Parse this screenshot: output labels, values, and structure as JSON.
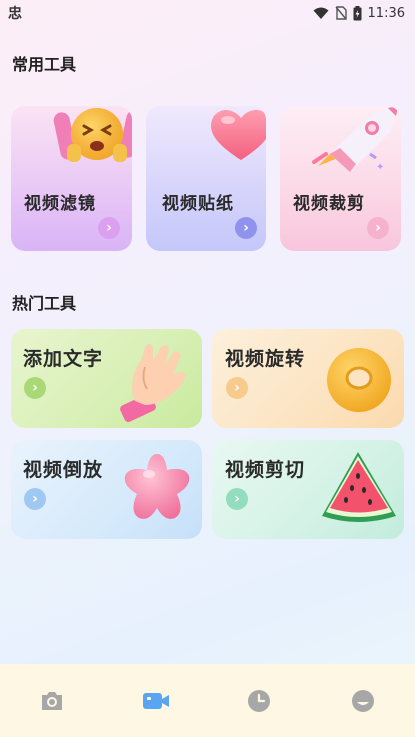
{
  "status_bar": {
    "app_glyph": "忠",
    "time": "11:36",
    "icons": [
      "wifi-icon",
      "no-sim-icon",
      "battery-icon"
    ]
  },
  "common_tools": {
    "title": "常用工具",
    "items": [
      {
        "label": "视频滤镜",
        "icon": "emoji-face-icon"
      },
      {
        "label": "视频贴纸",
        "icon": "heart-icon"
      },
      {
        "label": "视频裁剪",
        "icon": "rocket-icon"
      }
    ]
  },
  "hot_tools": {
    "title": "热门工具",
    "items": [
      {
        "label": "添加文字",
        "icon": "hand-icon"
      },
      {
        "label": "视频旋转",
        "icon": "donut-icon"
      },
      {
        "label": "视频倒放",
        "icon": "jelly-star-icon"
      },
      {
        "label": "视频剪切",
        "icon": "watermelon-icon"
      }
    ]
  },
  "bottom_nav": {
    "items": [
      "camera-icon",
      "video-camera-icon",
      "clock-icon",
      "profile-icon"
    ],
    "active_index": 1
  },
  "colors": {
    "nav_bg": "#fdf7e3",
    "nav_active": "#5aa5f2",
    "nav_inactive": "#a7a7a7"
  }
}
